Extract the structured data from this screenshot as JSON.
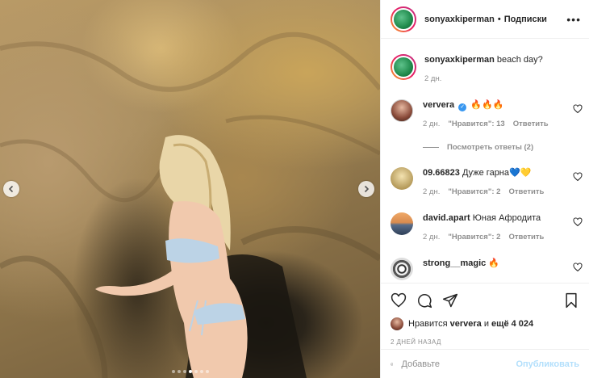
{
  "post": {
    "author": "sonyaxkiperman",
    "separator": "•",
    "follow_label": "Подписки",
    "more_label": "•••",
    "caption_author": "sonyaxkiperman",
    "caption_text": "beach day?",
    "caption_time": "2 дн.",
    "carousel": {
      "total": 7,
      "active": 4
    }
  },
  "comments": [
    {
      "user": "ververa",
      "verified": true,
      "text": "🔥🔥🔥",
      "time": "2 дн.",
      "likes": "\"Нравится\": 13",
      "reply": "Ответить"
    },
    {
      "user": "09.66823",
      "verified": false,
      "text": "Дуже гарна💙💛",
      "time": "2 дн.",
      "likes": "\"Нравится\": 2",
      "reply": "Ответить"
    },
    {
      "user": "david.apart",
      "verified": false,
      "text": "Юная Афродита",
      "time": "2 дн.",
      "likes": "\"Нравится\": 2",
      "reply": "Ответить"
    },
    {
      "user": "strong__magic",
      "verified": false,
      "text": "🔥",
      "time": "",
      "likes": "",
      "reply": ""
    }
  ],
  "view_replies": "Посмотреть ответы (2)",
  "likes_line": {
    "prefix": "Нравится",
    "user": "ververa",
    "middle": "и",
    "count": "ещё 4 024"
  },
  "date_label": "2 ДНЕЙ НАЗАД",
  "comment_box": {
    "placeholder": "Добавьте",
    "publish": "Опубликовать"
  },
  "colors": {
    "accent": "#3897f0",
    "publish_disabled": "#b2dffc",
    "muted": "#8e8e8e"
  }
}
